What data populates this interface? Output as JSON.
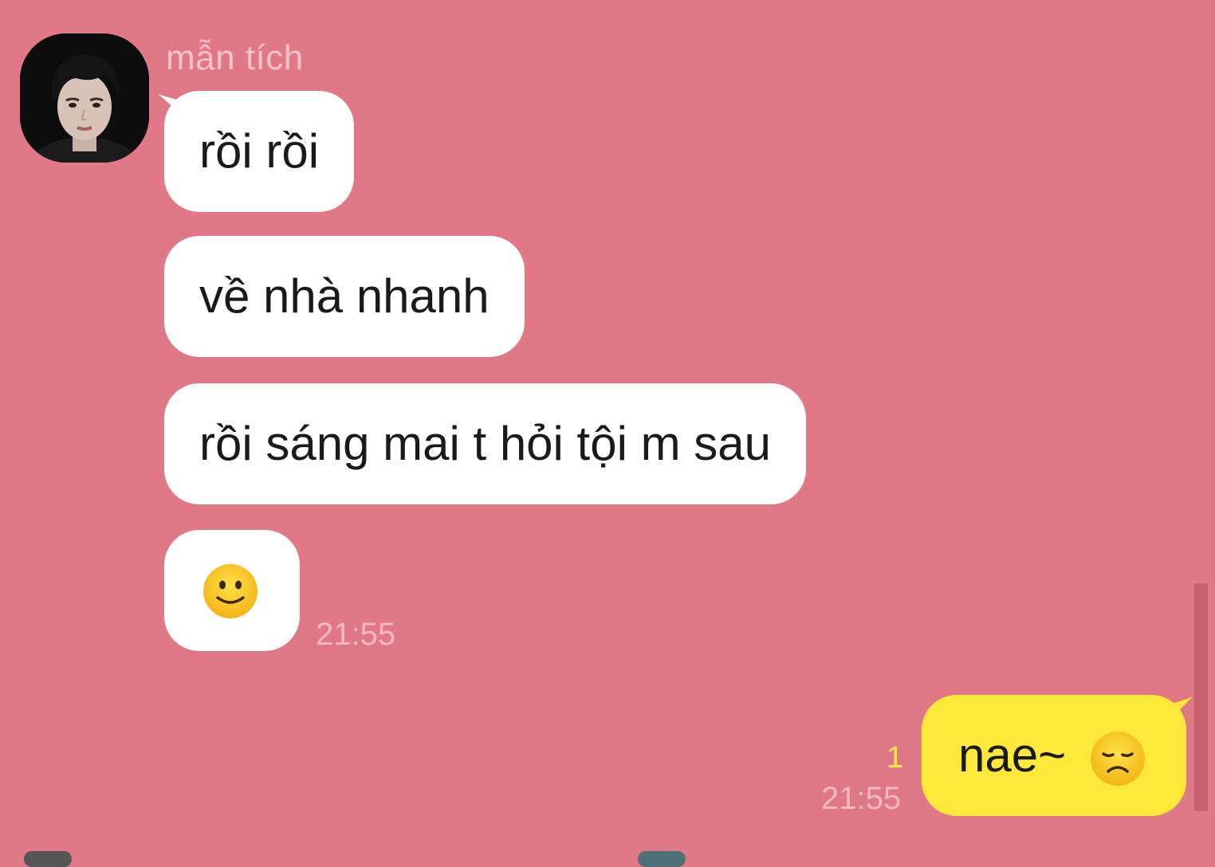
{
  "colors": {
    "background": "#e07885",
    "incoming_bubble": "#ffffff",
    "outgoing_bubble": "#fde93b",
    "sender_name": "#f6c3ca",
    "timestamp": "#f2b9c1",
    "read_count": "#ffe94a"
  },
  "incoming": {
    "sender_name": "mẫn tích",
    "avatar_icon": "profile-photo",
    "messages": [
      {
        "text": "rồi rồi"
      },
      {
        "text": "về nhà nhanh"
      },
      {
        "text": "rồi sáng mai t hỏi tội m sau"
      },
      {
        "emoji": "slightly-smiling-face"
      }
    ],
    "time": "21:55"
  },
  "outgoing": {
    "messages": [
      {
        "text": "nae~",
        "emoji": "disappointed-face"
      }
    ],
    "unread_count": "1",
    "time": "21:55"
  }
}
